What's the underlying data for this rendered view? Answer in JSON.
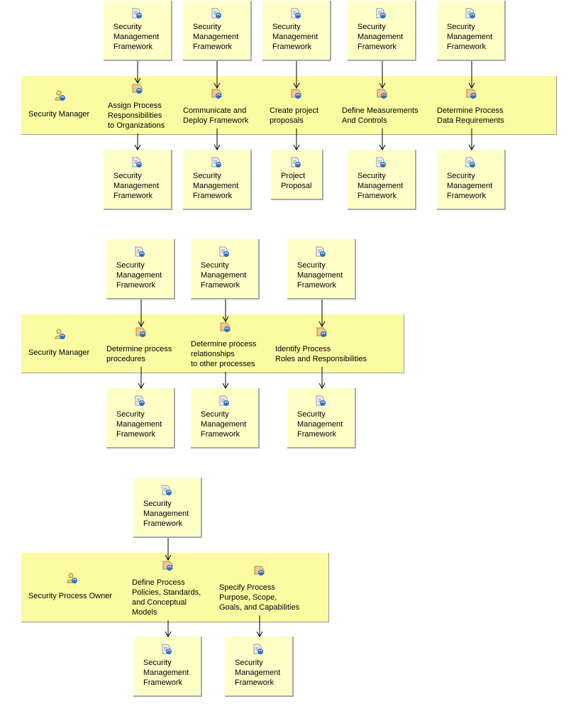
{
  "colors": {
    "band": "#fbfba2",
    "artifact": "#ffffc8",
    "arrow": "#000000"
  },
  "icons": {
    "artifact": "document-refresh-icon",
    "task": "task-refresh-icon",
    "role": "role-person-icon"
  },
  "sections": [
    {
      "role": "Security Manager",
      "tasks": [
        {
          "label": "Assign Process\nResponsibilities\nto Organizations",
          "input": "Security\nManagement\nFramework",
          "output": "Security\nManagement\nFramework"
        },
        {
          "label": "Communicate and\nDeploy Framework",
          "input": "Security\nManagement\nFramework",
          "output": "Security\nManagement\nFramework"
        },
        {
          "label": "Create project\nproposals",
          "input": "Security\nManagement\nFramework",
          "output": "Project\nProposal"
        },
        {
          "label": "Define Measurements\nAnd Controls",
          "input": "Security\nManagement\nFramework",
          "output": "Security\nManagement\nFramework"
        },
        {
          "label": "Determine Process\nData Requirements",
          "input": "Security\nManagement\nFramework",
          "output": "Security\nManagement\nFramework"
        }
      ]
    },
    {
      "role": "Security Manager",
      "tasks": [
        {
          "label": "Determine process\nprocedures",
          "input": "Security\nManagement\nFramework",
          "output": "Security\nManagement\nFramework"
        },
        {
          "label": "Determine process\nrelationships\nto other processes",
          "input": "Security\nManagement\nFramework",
          "output": "Security\nManagement\nFramework"
        },
        {
          "label": "Identify Process\nRoles and Responsibilities",
          "input": "Security\nManagement\nFramework",
          "output": "Security\nManagement\nFramework"
        }
      ]
    },
    {
      "role": "Security Process Owner",
      "tasks": [
        {
          "label": "Define Process\nPolicies, Standards,\nand Conceptual\nModels",
          "input": "Security\nManagement\nFramework",
          "output": "Security\nManagement\nFramework"
        },
        {
          "label": "Specify Process\nPurpose, Scope,\nGoals, and Capabilities",
          "output": "Security\nManagement\nFramework"
        }
      ]
    }
  ]
}
